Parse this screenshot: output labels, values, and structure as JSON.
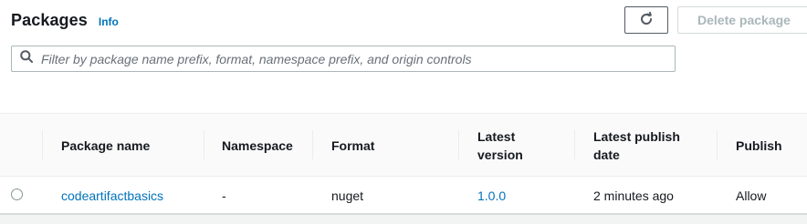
{
  "header": {
    "title": "Packages",
    "info_label": "Info"
  },
  "toolbar": {
    "refresh_icon": "refresh-icon",
    "delete_label": "Delete package"
  },
  "search": {
    "placeholder": "Filter by package name prefix, format, namespace prefix, and origin controls",
    "value": "",
    "icon": "search-icon"
  },
  "table": {
    "columns": [
      {
        "label": "Package name"
      },
      {
        "label": "Namespace"
      },
      {
        "label": "Format"
      },
      {
        "label": "Latest\nversion"
      },
      {
        "label": "Latest publish\ndate"
      },
      {
        "label": "Publish"
      }
    ],
    "rows": [
      {
        "package_name": "codeartifactbasics",
        "namespace": "-",
        "format": "nuget",
        "latest_version": "1.0.0",
        "latest_publish_date": "2 minutes ago",
        "publish": "Allow"
      }
    ]
  },
  "colors": {
    "link": "#0073bb",
    "text": "#16191f",
    "disabled": "#aab7b8",
    "header_bg": "#fafafa"
  }
}
